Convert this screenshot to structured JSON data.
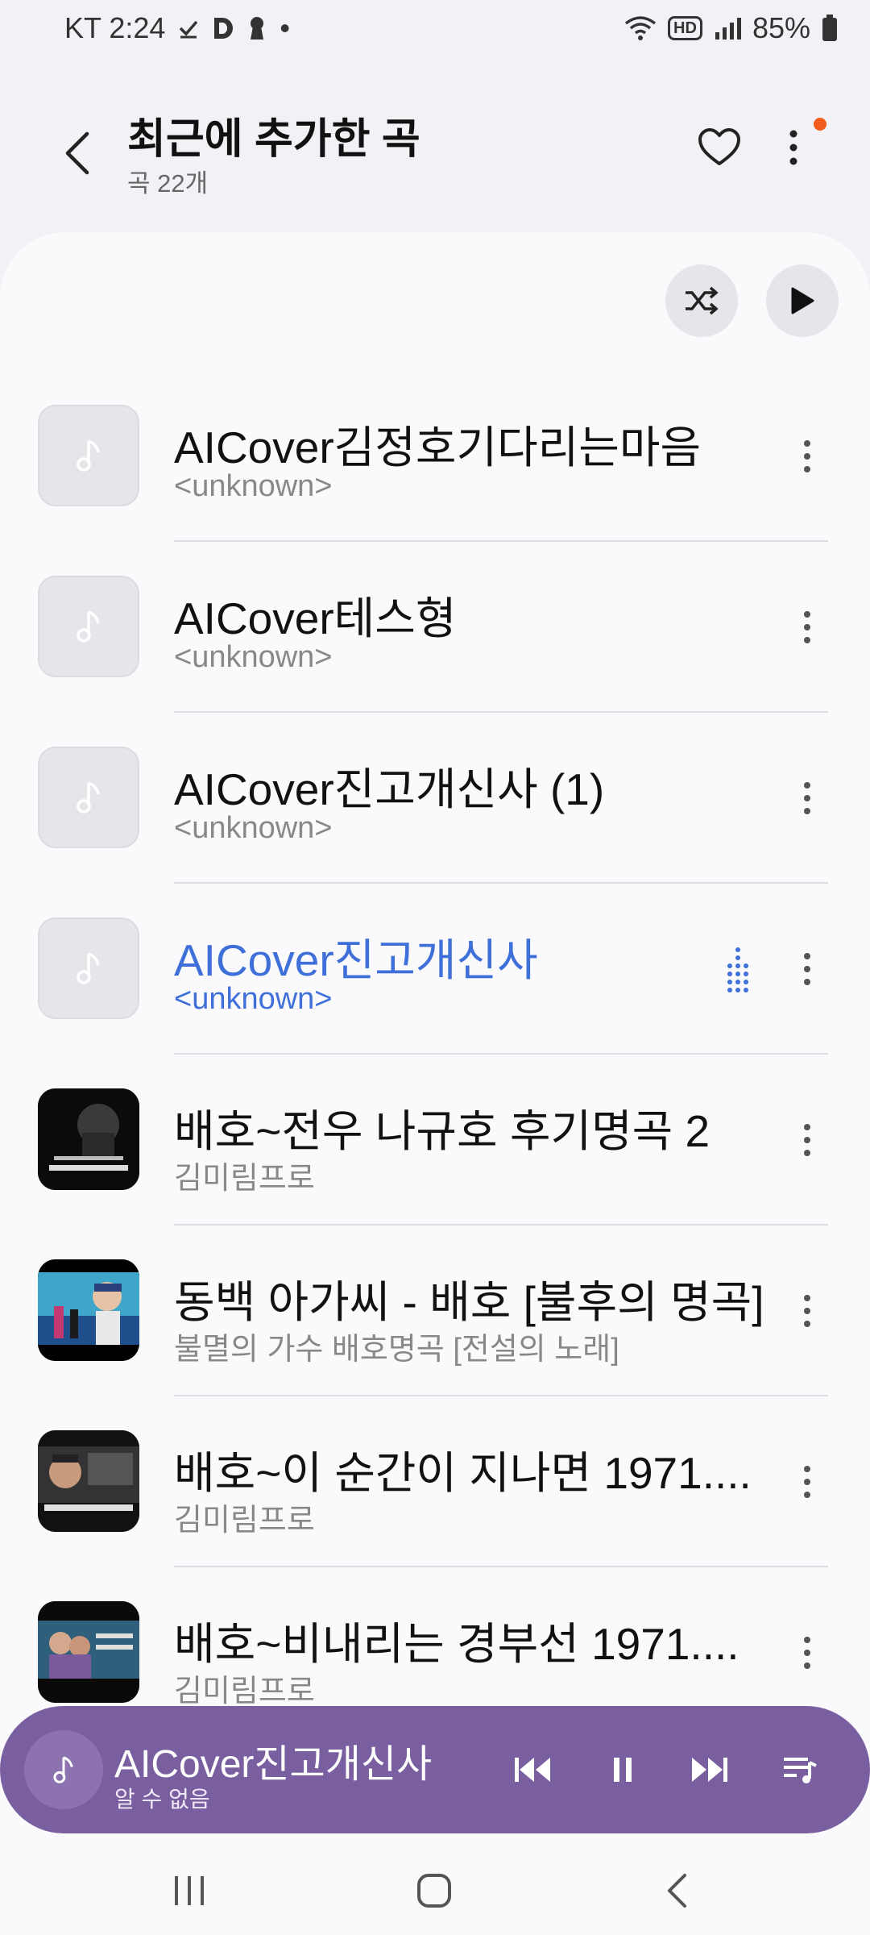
{
  "status_bar": {
    "carrier_time": "KT 2:24",
    "indicator_dot": "•",
    "hd_label": "HD",
    "battery": "85%"
  },
  "header": {
    "title": "최근에 추가한 곡",
    "subtitle": "곡 22개"
  },
  "songs": [
    {
      "title": "AICover김정호기다리는마음",
      "artist": "<unknown>"
    },
    {
      "title": "AICover테스형",
      "artist": "<unknown>"
    },
    {
      "title": "AICover진고개신사 (1)",
      "artist": "<unknown>"
    },
    {
      "title": "AICover진고개신사",
      "artist": "<unknown>",
      "playing": true
    },
    {
      "title": "배호~전우 나규호 후기명곡 2",
      "artist": "김미림프로"
    },
    {
      "title": "동백 아가씨 - 배호 [불후의 명곡]",
      "artist": "불멸의 가수 배호명곡 [전설의 노래]"
    },
    {
      "title": "배호~이 순간이 지나면 1971....",
      "artist": "김미림프로"
    },
    {
      "title": "배호~비내리는 경부선 1971....",
      "artist": "김미림프로"
    }
  ],
  "mini_player": {
    "title": "AICover진고개신사",
    "artist": "알 수 없음"
  },
  "colors": {
    "accent_playing": "#3f6fd8",
    "mini_player_bg": "#7a5fa0",
    "notification_dot": "#f25c1c"
  }
}
